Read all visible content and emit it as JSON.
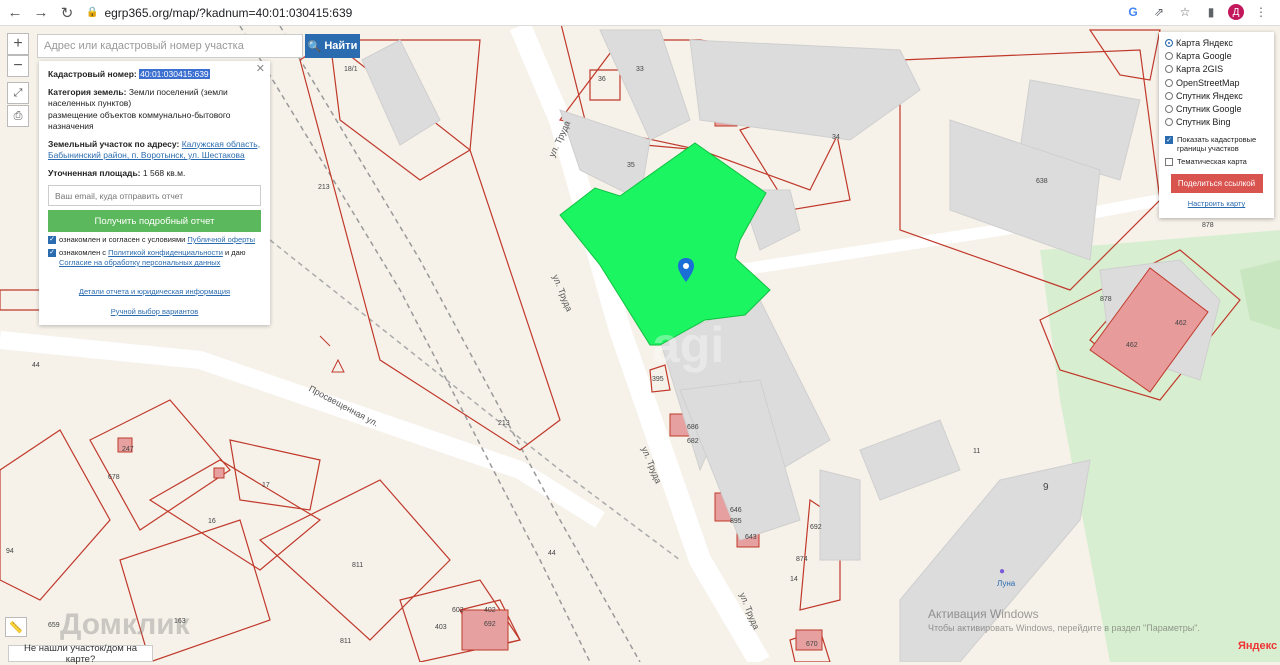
{
  "browser": {
    "url": "egrp365.org/map/?kadnum=40:01:030415:639",
    "avatar_letter": "Д"
  },
  "search": {
    "placeholder": "Адрес или кадастровый номер участка",
    "button_label": "Найти"
  },
  "info": {
    "cadastral_label": "Кадастровый номер:",
    "cadastral_value": "40:01:030415:639",
    "category_label": "Категория земель:",
    "category_value": "Земли поселений (земли населенных пунктов)",
    "purpose_value": "размещение объектов коммунально-бытового назначения",
    "address_label": "Земельный участок по адресу:",
    "address_value": "Калужская область, Бабынинский район, п. Воротынск, ул. Шестакова",
    "area_label": "Уточненная площадь:",
    "area_value": "1 568 кв.м.",
    "email_placeholder": "Ваш email, куда отправить отчет",
    "report_button": "Получить подробный отчет",
    "consent1_text": "ознакомлен и согласен с условиями",
    "consent1_link": "Публичной оферты",
    "consent2_text": "ознакомлен с",
    "consent2_link": "Политикой конфиденциальности",
    "consent2_tail": "и даю",
    "consent2_link2": "Согласие на обработку персональных данных",
    "details_link": "Детали отчета и юридическая информация",
    "manual_link": "Ручной выбор вариантов"
  },
  "layers": {
    "options": [
      {
        "label": "Карта Яндекс",
        "selected": true
      },
      {
        "label": "Карта Google",
        "selected": false
      },
      {
        "label": "Карта 2GIS",
        "selected": false
      },
      {
        "label": "OpenStreetMap",
        "selected": false
      },
      {
        "label": "Спутник Яндекс",
        "selected": false
      },
      {
        "label": "Спутник Google",
        "selected": false
      },
      {
        "label": "Спутник Bing",
        "selected": false
      }
    ],
    "show_bounds_label": "Показать кадастровые границы участков",
    "thematic_label": "Тематическая карта",
    "share_button": "Поделиться ссылкой",
    "settings_link": "Настроить карту"
  },
  "map_labels": {
    "street_truda": "ул. Труда",
    "street_prosv": "Просвещенная ул.",
    "poi_luna": "Луна",
    "watermark": "Домклик",
    "parcels": [
      "33",
      "36",
      "34",
      "35",
      "638",
      "878",
      "878",
      "462",
      "462",
      "18/1",
      "213",
      "213",
      "44",
      "395",
      "682",
      "686",
      "678",
      "17",
      "16",
      "811",
      "811",
      "94",
      "163",
      "659",
      "403",
      "402",
      "692",
      "692",
      "874",
      "14",
      "895",
      "646",
      "643",
      "9",
      "11",
      "670",
      "44",
      "247",
      "602"
    ]
  },
  "not_found_button": "Не нашли участок/дом на карте?",
  "activation": {
    "title": "Активация Windows",
    "subtitle": "Чтобы активировать Windows, перейдите в раздел \"Параметры\"."
  },
  "yandex_logo": "Яндекс",
  "colors": {
    "parcel_highlight": "#1cf562",
    "parcel_border": "#c0392b",
    "building": "#dcdcdc",
    "green_area": "#d6efcf"
  }
}
